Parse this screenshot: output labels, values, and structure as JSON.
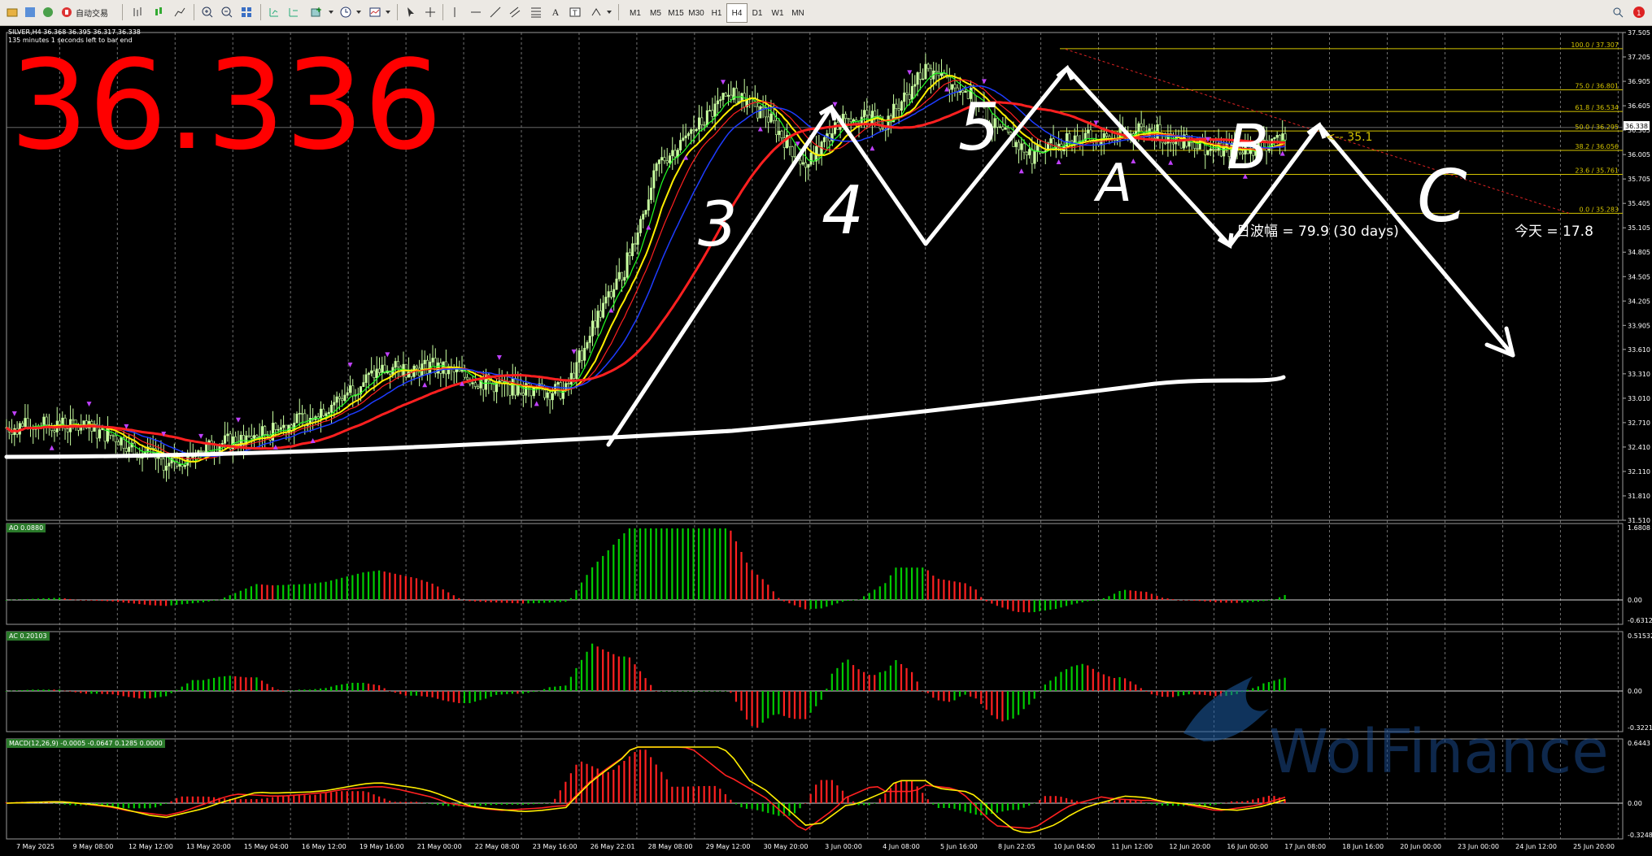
{
  "toolbar": {
    "autotrade_label": "自动交易",
    "timeframes": [
      "M1",
      "M5",
      "M15",
      "M30",
      "H1",
      "H4",
      "D1",
      "W1",
      "MN"
    ],
    "active_timeframe": "H4"
  },
  "chart": {
    "header": "SILVER,H4  36.368 36.395 36.317 36.338",
    "subheader": "135 minutes 1 seconds left to bar end",
    "big_price": "36.336",
    "current_price_tag": "36.338",
    "range_text": "日波幅 = 79.9  (30 days)",
    "today_text": "今天 = 17.8",
    "arrow_label": "<-- 35.1",
    "watermark": "WolFinance",
    "wave_labels": [
      "3",
      "4",
      "5",
      "A",
      "B",
      "C"
    ],
    "price_axis": [
      "37.505",
      "37.205",
      "36.905",
      "36.605",
      "36.305",
      "36.005",
      "35.705",
      "35.405",
      "35.105",
      "34.805",
      "34.505",
      "34.205",
      "33.905",
      "33.610",
      "33.310",
      "33.010",
      "32.710",
      "32.410",
      "32.110",
      "31.810",
      "31.510"
    ],
    "time_axis": [
      "7 May 2025",
      "9 May 08:00",
      "12 May 12:00",
      "13 May 20:00",
      "15 May 04:00",
      "16 May 12:00",
      "19 May 16:00",
      "21 May 00:00",
      "22 May 08:00",
      "23 May 16:00",
      "26 May 22:01",
      "28 May 08:00",
      "29 May 12:00",
      "30 May 20:00",
      "3 Jun 00:00",
      "4 Jun 08:00",
      "5 Jun 16:00",
      "8 Jun 22:05",
      "10 Jun 04:00",
      "11 Jun 12:00",
      "12 Jun 20:00",
      "16 Jun 00:00",
      "17 Jun 08:00",
      "18 Jun 16:00",
      "20 Jun 00:00",
      "23 Jun 00:00",
      "24 Jun 12:00",
      "25 Jun 20:00"
    ],
    "fib_levels": [
      {
        "label": "100.0  /  37.307"
      },
      {
        "label": "75.0  /  36.801"
      },
      {
        "label": "61.8  /  36.534"
      },
      {
        "label": "50.0  /  36.295"
      },
      {
        "label": "38.2  /  36.056"
      },
      {
        "label": "23.6  /  35.761"
      },
      {
        "label": "0.0  /  35.283"
      }
    ]
  },
  "panes": {
    "ao": {
      "label": "AO 0.0880",
      "top": "1.6808",
      "zero": "0.00",
      "bottom": "-0.6312"
    },
    "ac": {
      "label": "AC 0.20103",
      "top": "0.51532",
      "zero": "0.00",
      "bottom": "-0.3221"
    },
    "macd": {
      "label": "MACD(12,26,9) -0.0005 -0.0647 0.1285 0.0000",
      "top": "0.6443",
      "zero": "0.00",
      "bottom": "-0.3248"
    }
  },
  "colors": {
    "up": "#00cc00",
    "down": "#ff2020",
    "candle": "#c8ffa0",
    "fib": "#d4c400",
    "ma_red": "#ff2020",
    "ma_blue": "#1e3cff",
    "ma_yellow": "#ffee00",
    "ma_green": "#22ff22",
    "big_price": "#ff0000"
  }
}
